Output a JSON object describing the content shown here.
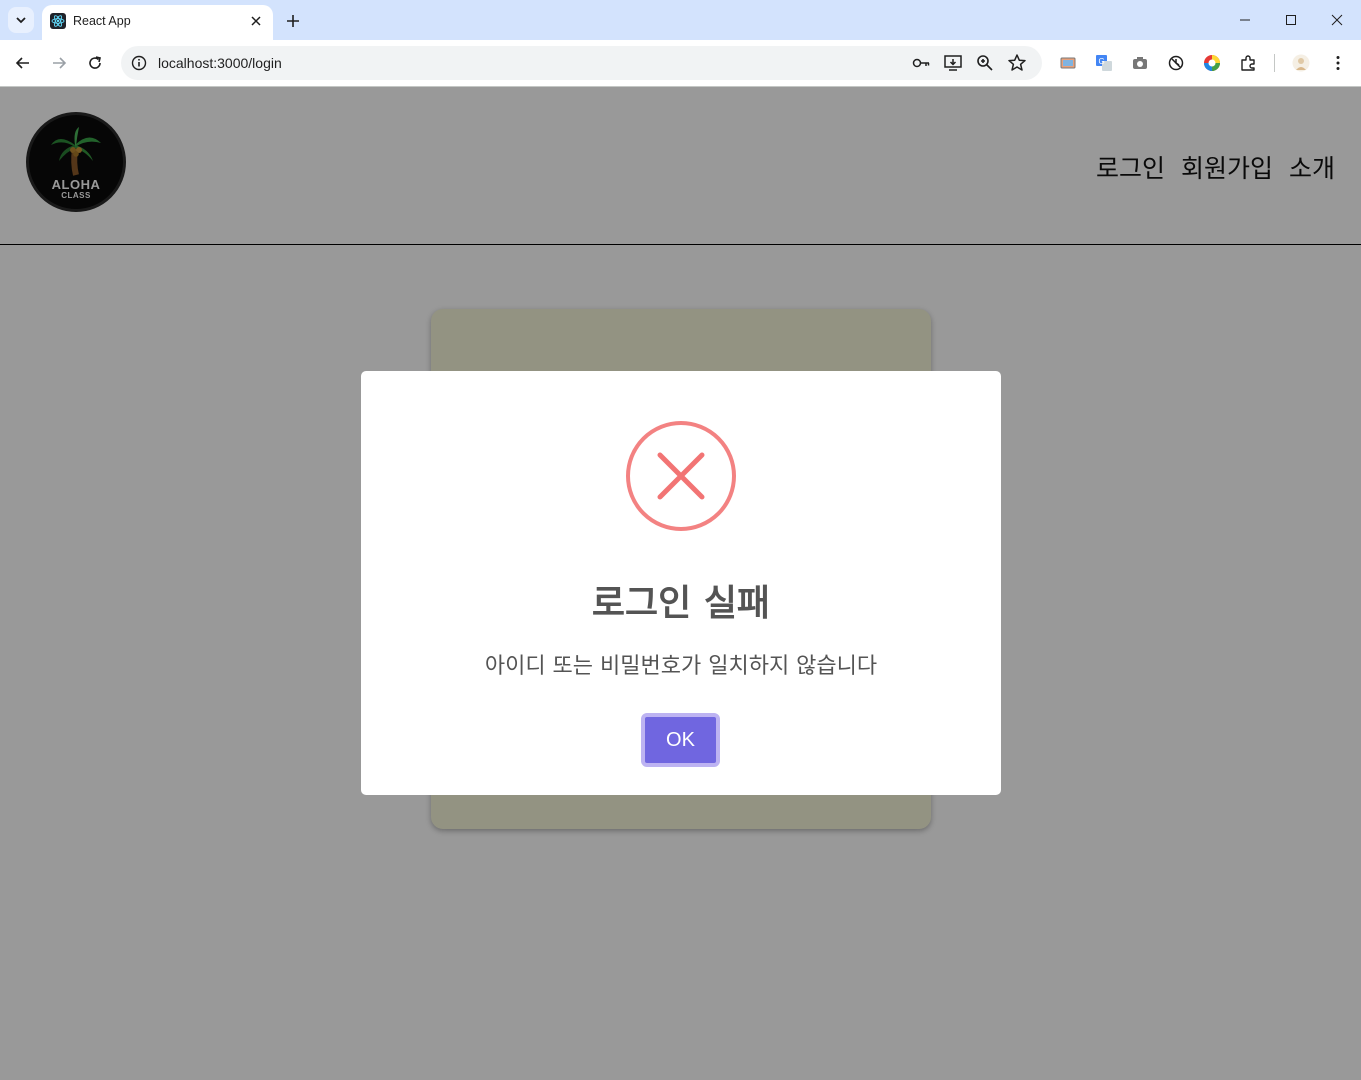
{
  "browser": {
    "tab_title": "React App",
    "url": "localhost:3000/login"
  },
  "site": {
    "logo_word1": "ALOHA",
    "logo_word2": "CLASS",
    "nav": [
      "로그인",
      "회원가입",
      "소개"
    ]
  },
  "dialog": {
    "icon": "error-x-icon",
    "title": "로그인 실패",
    "message": "아이디 또는 비밀번호가 일치하지 않습니다",
    "confirm_label": "OK",
    "icon_color": "#f27474",
    "button_color": "#7066e0"
  }
}
